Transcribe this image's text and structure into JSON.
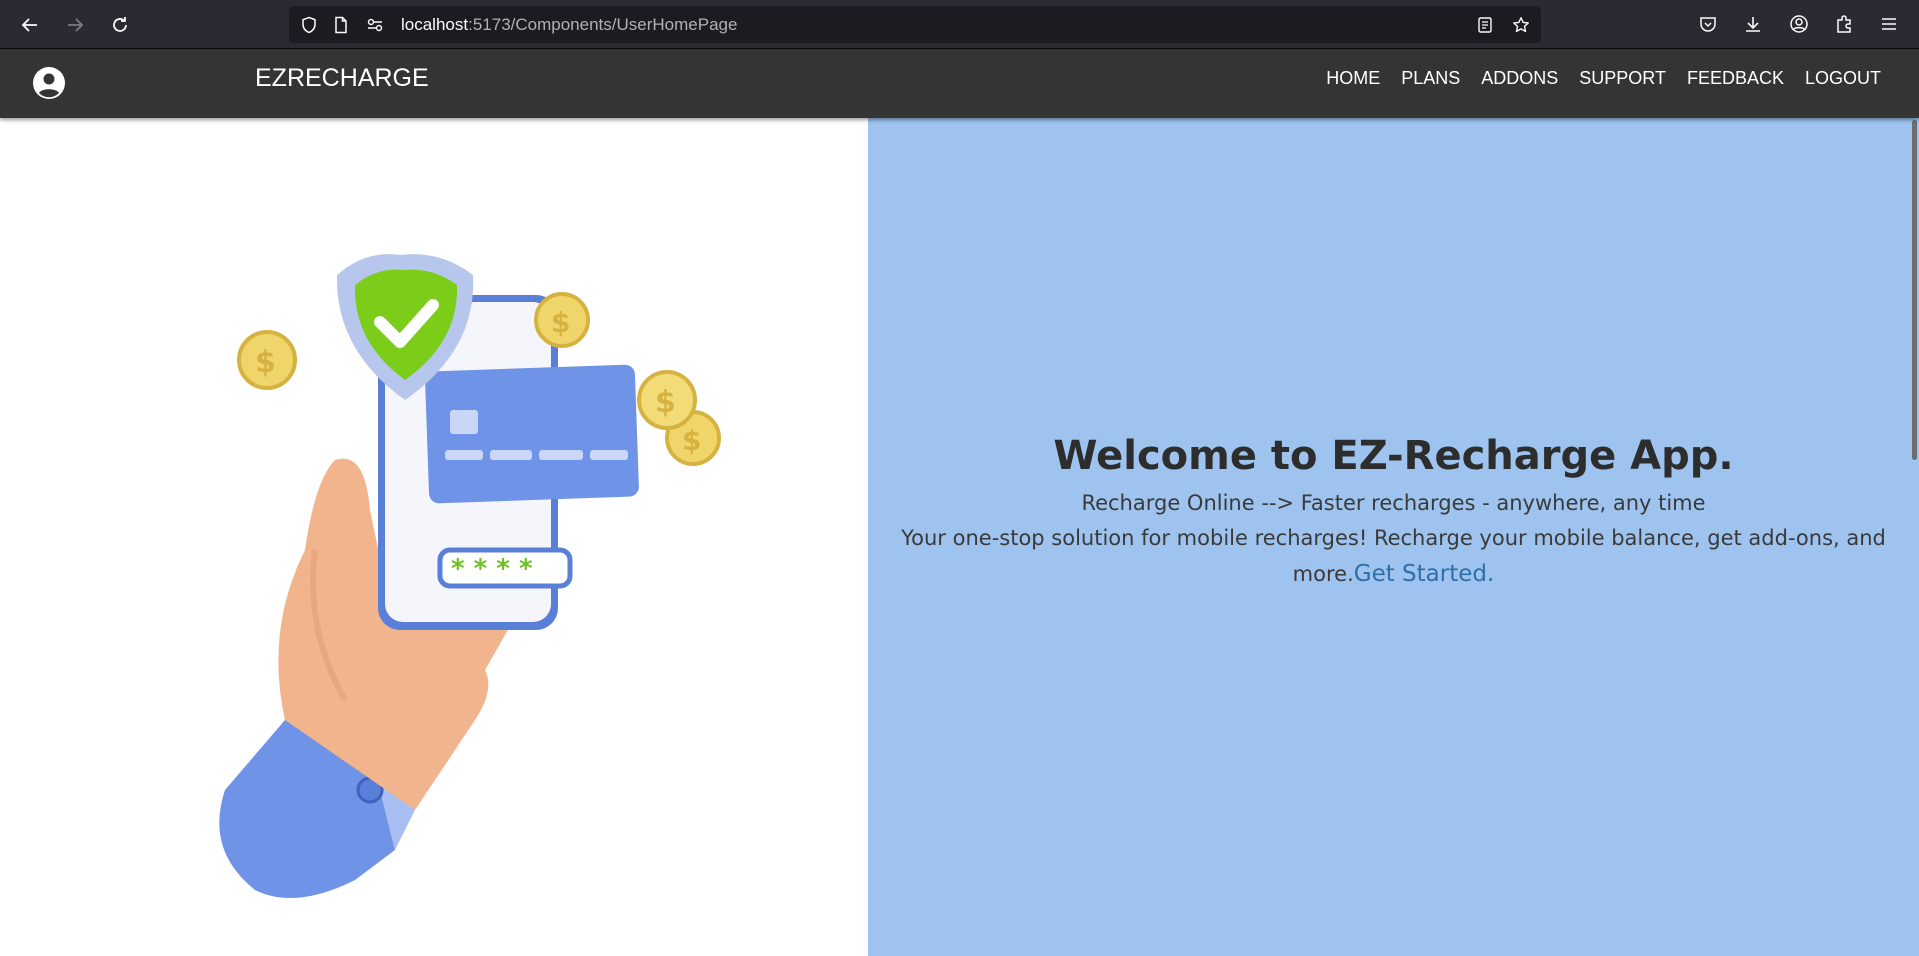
{
  "browser": {
    "url_host": "localhost",
    "url_path": ":5173/Components/UserHomePage"
  },
  "app": {
    "brand": "EZRECHARGE",
    "nav": [
      "HOME",
      "PLANS",
      "ADDONS",
      "SUPPORT",
      "FEEDBACK",
      "LOGOUT"
    ]
  },
  "hero": {
    "title": "Welcome to EZ-Recharge App.",
    "tagline": "Recharge Online --> Faster recharges - anywhere, any time",
    "description": "Your one-stop solution for mobile recharges! Recharge your mobile balance, get add-ons, and more.",
    "cta": "Get Started."
  },
  "colors": {
    "header_bg": "#343434",
    "hero_bg": "#9dc3ee",
    "cta": "#2f6fa8"
  }
}
